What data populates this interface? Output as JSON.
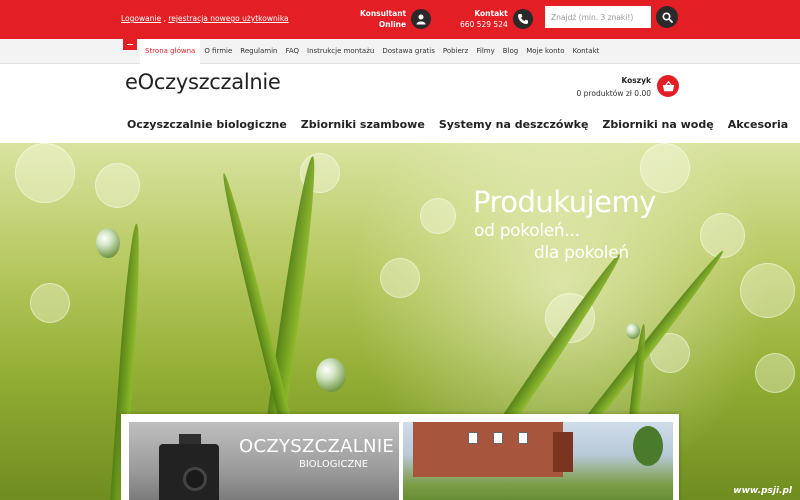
{
  "topbar": {
    "login_label": "Logowanie",
    "separator": ",",
    "register_label": "rejestracja nowego użytkownika",
    "consultant_line1": "Konsultant",
    "consultant_line2": "Online",
    "consultant_icon": "user-icon",
    "contact_line1": "Kontakt",
    "contact_phone": "660 529 524",
    "contact_icon": "phone-icon",
    "search_placeholder": "Znajdź (min. 3 znaki!)",
    "search_value": "",
    "search_icon": "search-icon",
    "accent_color": "#e31e24"
  },
  "subnav": {
    "home_icon": "home-icon",
    "items": [
      {
        "label": "Strona główna",
        "active": true
      },
      {
        "label": "O firmie"
      },
      {
        "label": "Regulamin"
      },
      {
        "label": "FAQ"
      },
      {
        "label": "Instrukcje montażu"
      },
      {
        "label": "Dostawa gratis"
      },
      {
        "label": "Pobierz"
      },
      {
        "label": "Filmy"
      },
      {
        "label": "Blog"
      },
      {
        "label": "Moje konto"
      },
      {
        "label": "Kontakt"
      }
    ]
  },
  "header": {
    "logo": "eOczyszczalnie",
    "cart_title": "Koszyk",
    "cart_summary": "0 produktów zł 0.00",
    "cart_icon": "basket-icon"
  },
  "mainnav": {
    "items": [
      {
        "label": "Oczyszczalnie biologiczne"
      },
      {
        "label": "Zbiorniki szambowe"
      },
      {
        "label": "Systemy na deszczówkę"
      },
      {
        "label": "Zbiorniki na wodę"
      },
      {
        "label": "Akcesoria"
      }
    ]
  },
  "hero": {
    "headline": "Produkujemy",
    "line2": "od pokoleń...",
    "line3": "dla pokoleń"
  },
  "panel": {
    "tile1_title": "OCZYSZCZALNIE",
    "tile1_subtitle": "BIOLOGICZNE"
  },
  "watermark": "www.psji.pl"
}
